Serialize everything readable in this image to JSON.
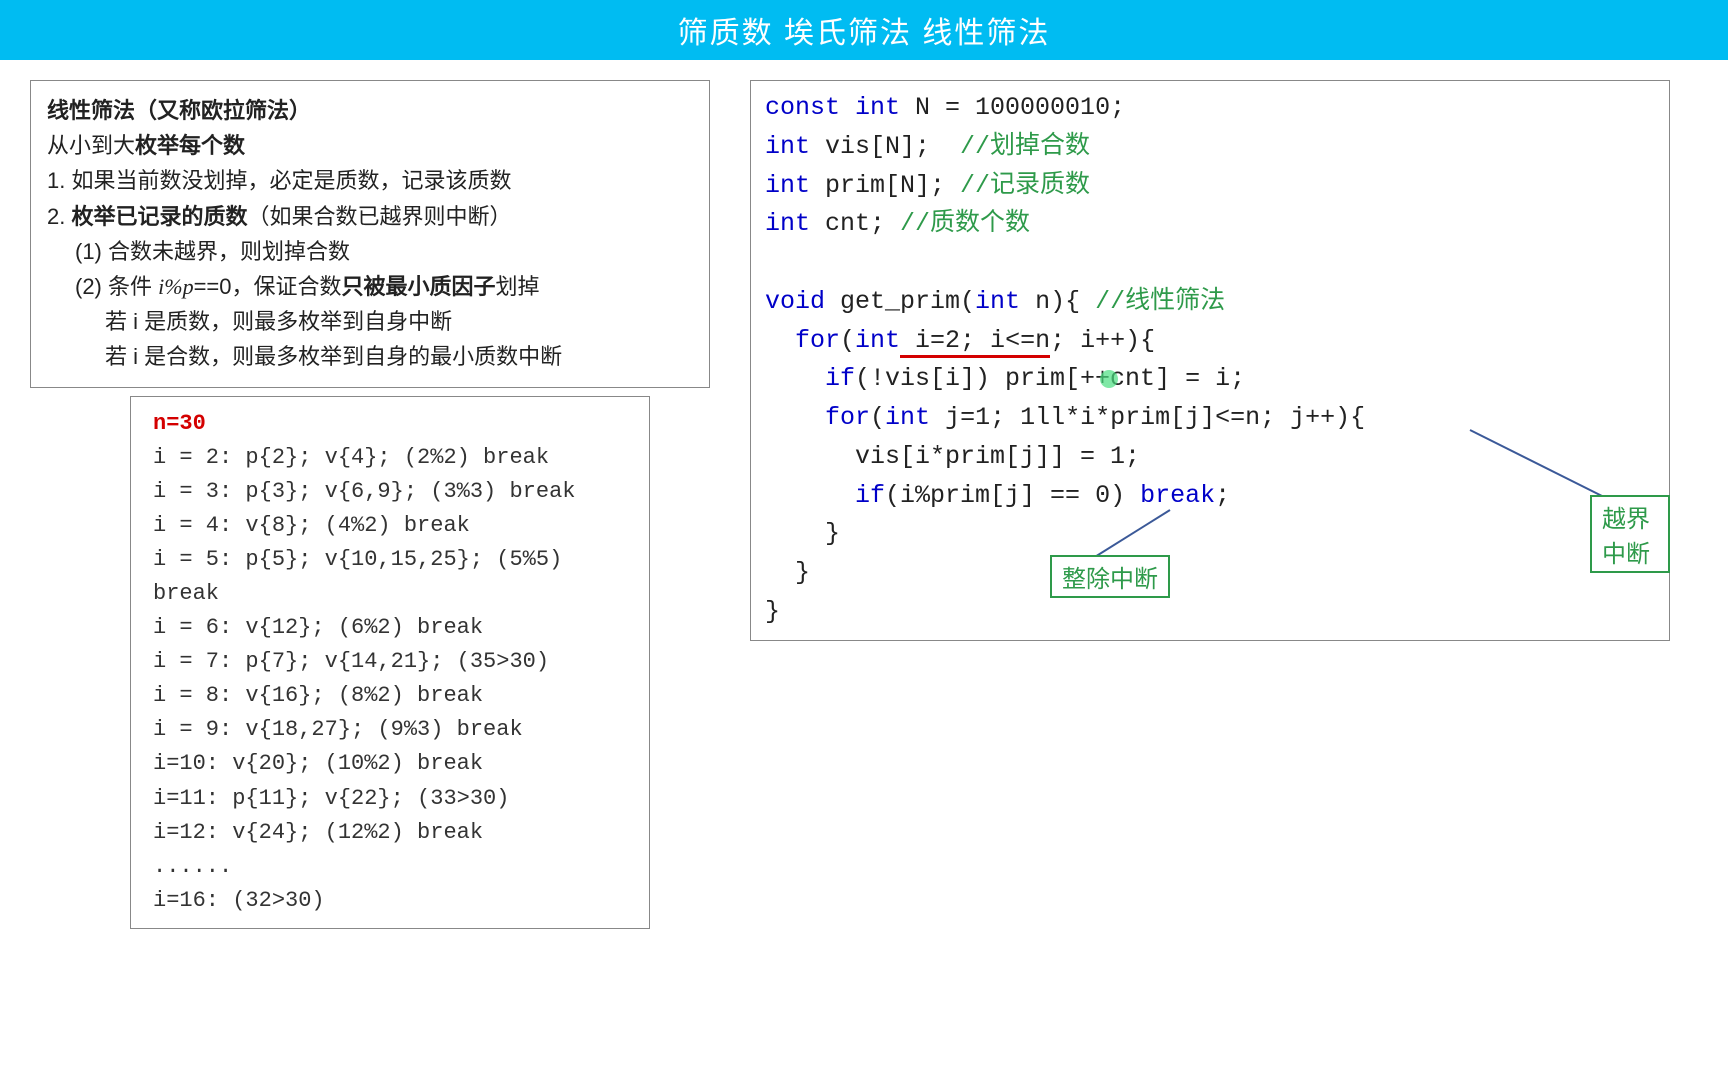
{
  "header": {
    "title": "筛质数 埃氏筛法 线性筛法"
  },
  "explain": {
    "title_a": "线性筛法（又称",
    "title_b": "欧拉筛法",
    "title_c": "）",
    "line2a": "从小到大",
    "line2b": "枚举每个数",
    "line3": "1. 如果当前数没划掉，必定是质数，记录该质数",
    "line4a": "2. ",
    "line4b": "枚举已记录的质数",
    "line4c": "（如果合数已越界则中断）",
    "line5": "(1) 合数未越界，则划掉合数",
    "line6a": "(2) 条件 ",
    "line6b": "i%p",
    "line6c": "==0，保证合数",
    "line6d": "只被最小质因子",
    "line6e": "划掉",
    "line7": "若 i 是质数，则最多枚举到自身中断",
    "line8": "若 i 是合数，则最多枚举到自身的最小质数中断"
  },
  "trace": {
    "n_label": "n=30",
    "rows": [
      "i = 2:  p{2};   v{4};     (2%2) break",
      "i = 3:  p{3};   v{6,9};  (3%3) break",
      "i = 4:           v{8};     (4%2) break",
      "i = 5:  p{5};   v{10,15,25};  (5%5) break",
      "i = 6:           v{12};    (6%2) break",
      "i = 7:  p{7};   v{14,21};  (35>30)",
      "i = 8:           v{16};    (8%2) break",
      "i = 9:           v{18,27};  (9%3) break",
      "i=10:           v{20};    (10%2) break",
      "i=11:  p{11}; v{22};    (33>30)",
      "i=12:           v{24};    (12%2) break",
      "......",
      "i=16:           (32>30)"
    ]
  },
  "code": {
    "l1a": "const int",
    "l1b": " N = 100000010;",
    "l2a": "int",
    "l2b": " vis[N];  ",
    "l2c": "//划掉合数",
    "l3a": "int",
    "l3b": " prim[N]; ",
    "l3c": "//记录质数",
    "l4a": "int",
    "l4b": " cnt; ",
    "l4c": "//质数个数",
    "l5": "",
    "l6a": "void",
    "l6b": " get_prim(",
    "l6c": "int",
    "l6d": " n){ ",
    "l6e": "//线性筛法",
    "l7a": "  for",
    "l7b": "(",
    "l7c": "int",
    "l7d_u": " i=2; i<=n",
    "l7e": "; i++){",
    "l8a": "    if",
    "l8b": "(!vis[i]) prim[++cnt] = i;",
    "l9a": "    for",
    "l9b": "(",
    "l9c": "int",
    "l9d": " j=1; 1ll*i*prim[j]<=n; j++){",
    "l10": "      vis[i*prim[j]] = 1;",
    "l11a": "      if",
    "l11b": "(i%prim[j] == 0) ",
    "l11c": "break",
    "l11d": ";",
    "l12": "    }",
    "l13": "  }",
    "l14": "}"
  },
  "annots": {
    "a1": "越界中断",
    "a2": "整除中断"
  }
}
